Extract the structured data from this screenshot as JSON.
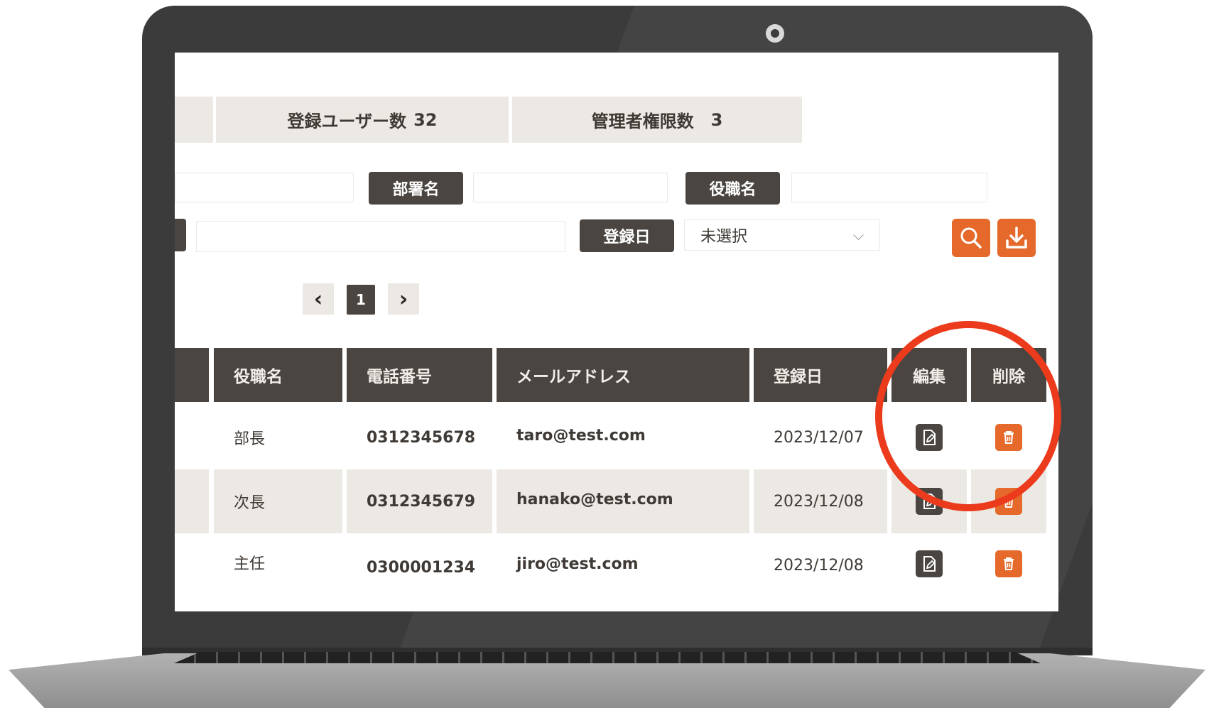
{
  "stats": {
    "users_label": "登録ユーザー数",
    "users_count": "32",
    "admins_label": "管理者権限数",
    "admins_count": "3"
  },
  "filters": {
    "department_label": "部署名",
    "position_label": "役職名",
    "date_label": "登録日",
    "date_select_value": "未選択"
  },
  "pagination": {
    "prev": "‹",
    "current": "1",
    "next": "›"
  },
  "table": {
    "headers": [
      "役職名",
      "電話番号",
      "メールアドレス",
      "登録日",
      "編集",
      "削除"
    ],
    "rows": [
      {
        "position": "部長",
        "phone": "0312345678",
        "email": "taro@test.com",
        "date": "2023/12/07"
      },
      {
        "position": "次長",
        "phone": "0312345679",
        "email": "hanako@test.com",
        "date": "2023/12/08"
      },
      {
        "position": "主任",
        "phone": "0300001234",
        "email": "jiro@test.com",
        "date": "2023/12/08"
      }
    ]
  },
  "icons": {
    "search": "search-icon",
    "download": "download-icon",
    "edit": "edit-document-icon",
    "delete": "trash-icon",
    "select_chevron": "chevron-down-icon",
    "webcam": "camera-icon"
  },
  "colors": {
    "header_dark": "#4a4540",
    "accent_orange": "#e5692a",
    "row_alt": "#ece9e4",
    "highlight_red": "#ec3a1c",
    "bezel": "#3b3b3b"
  }
}
